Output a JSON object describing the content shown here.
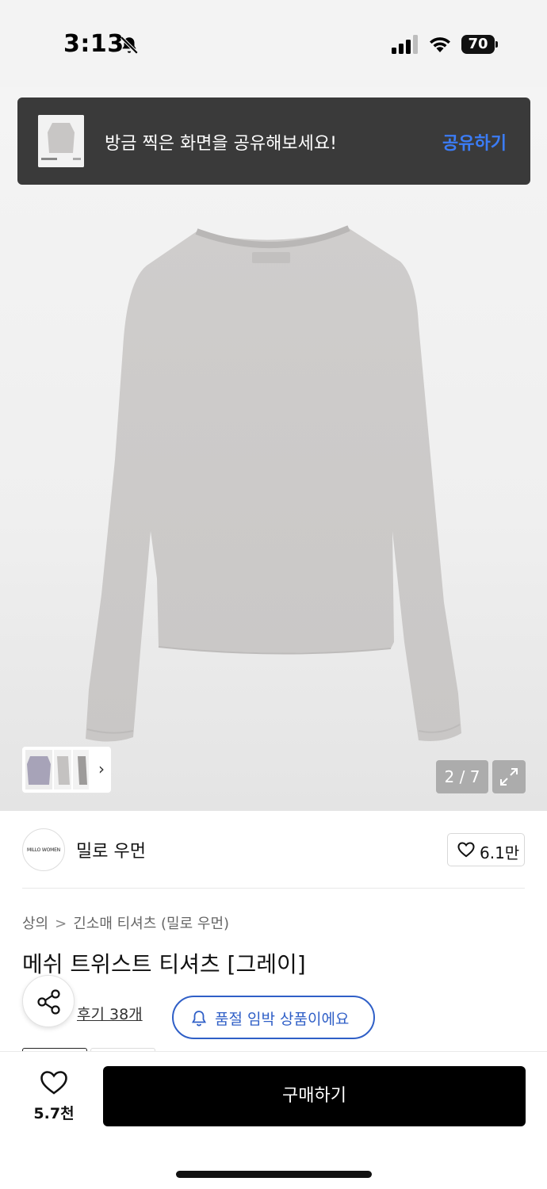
{
  "status_bar": {
    "time": "3:13",
    "battery": "70",
    "icons": [
      "bell-off-icon",
      "signal-icon",
      "wifi-icon",
      "battery-icon"
    ]
  },
  "share_toast": {
    "message": "방금 찍은 화면을 공유해보세요!",
    "action": "공유하기",
    "action_color": "#3b7cf6"
  },
  "gallery": {
    "counter": "2 / 7",
    "expand_icon": "expand-icon",
    "thumb_strip_chevron": "›"
  },
  "brand": {
    "logo_text": "MILLO WOMEN",
    "name": "밀로 우먼",
    "likes": "6.1만"
  },
  "breadcrumb": {
    "items": [
      "상의",
      "긴소매 티셔츠 (밀로 우먼)"
    ],
    "separator": ">"
  },
  "product": {
    "title": "메쉬 트위스트 티셔츠 [그레이]",
    "reviews": "후기 38개",
    "soldout_notice": "품절 임박 상품이에요",
    "accent_color": "#2f5fc7"
  },
  "bottom_bar": {
    "wish_count": "5.7천",
    "buy_label": "구매하기"
  }
}
